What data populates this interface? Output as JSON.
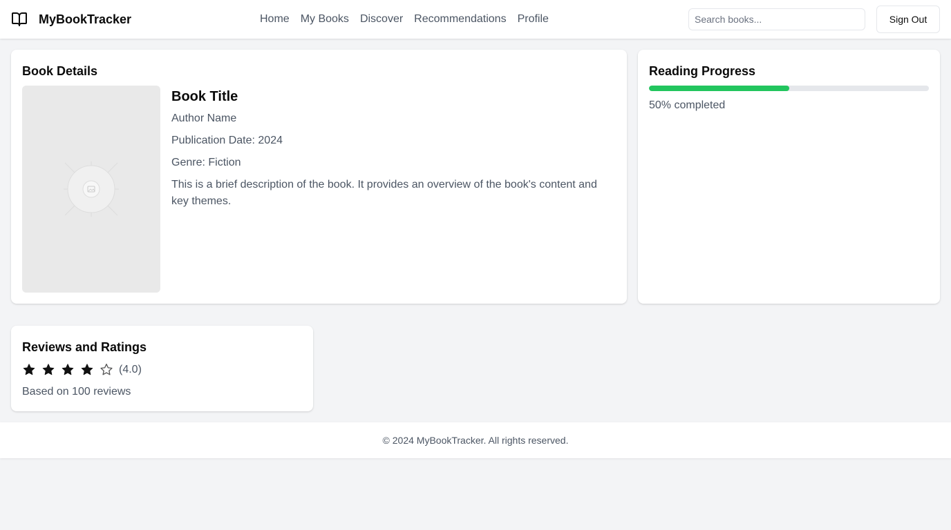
{
  "header": {
    "brand_name": "MyBookTracker",
    "brand_icon": "open-book-icon",
    "nav": [
      {
        "label": "Home"
      },
      {
        "label": "My Books"
      },
      {
        "label": "Discover"
      },
      {
        "label": "Recommendations"
      },
      {
        "label": "Profile"
      }
    ],
    "search_placeholder": "Search books...",
    "search_value": "",
    "sign_out_label": "Sign Out"
  },
  "book_details": {
    "section_title": "Book Details",
    "cover_icon": "image-placeholder-icon",
    "title": "Book Title",
    "author": "Author Name",
    "publication_date": "Publication Date: 2024",
    "genre": "Genre: Fiction",
    "description": "This is a brief description of the book. It provides an overview of the book's content and key themes."
  },
  "reading_progress": {
    "section_title": "Reading Progress",
    "percent": 50,
    "label": "50% completed",
    "color": "#22c55e"
  },
  "reviews": {
    "section_title": "Reviews and Ratings",
    "rating": 4,
    "max_rating": 5,
    "rating_text": "(4.0)",
    "based_on": "Based on 100 reviews"
  },
  "footer": {
    "text": "© 2024 MyBookTracker. All rights reserved."
  }
}
